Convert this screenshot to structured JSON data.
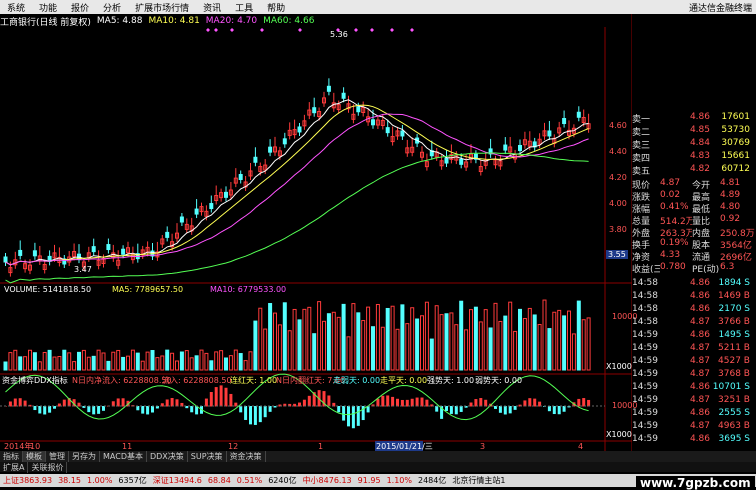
{
  "menu": {
    "items": [
      "系统",
      "功能",
      "报价",
      "分析",
      "扩展市场行情",
      "资讯",
      "工具",
      "帮助"
    ],
    "brand": "通达信金融终端"
  },
  "header": {
    "title": "工商银行(日线 前复权)",
    "ma5": "MA5: 4.88",
    "ma10": "MA10: 4.81",
    "ma20": "MA20: 4.70",
    "ma60": "MA60: 4.66",
    "high_label": "5.36",
    "low_label": "3.47"
  },
  "axis": {
    "price_ticks": [
      "4.60",
      "4.40",
      "4.20",
      "4.00",
      "3.80",
      "3.60"
    ],
    "current_price_tag": "3.55",
    "vol_ticks": [
      "10000"
    ],
    "vol_unit": "X1000",
    "ddx_ticks": [
      "10000"
    ],
    "ddx_unit": "X1000",
    "dates": [
      "2014年",
      "10",
      "11",
      "12",
      "1",
      "2015/01/21/三",
      "3",
      "4"
    ]
  },
  "volume_header": {
    "title": "VOLUME: 5141818.50",
    "ma5": "MA5: 7789657.50",
    "ma10": "MA10: 6779533.00"
  },
  "ddx_header": {
    "title": "资金博弈DDX指标",
    "n_inflow": "N日内净流入: 6228808.50",
    "inflow": "流入: 6228808.50",
    "streak": "连红天: 1.00",
    "n_streak": "N日内翻红天: 7.00",
    "net_days": "走弱天: 0.00",
    "down_days": "走平天: 0.00",
    "strong": "强势天: 1.00",
    "weak": "弱势天: 0.00"
  },
  "quote": {
    "asks": [
      {
        "label": "卖一",
        "price": "4.86",
        "vol": "17601"
      },
      {
        "label": "卖二",
        "price": "4.85",
        "vol": "53730"
      },
      {
        "label": "卖三",
        "price": "4.84",
        "vol": "30769"
      },
      {
        "label": "卖四",
        "price": "4.83",
        "vol": "15661"
      },
      {
        "label": "卖五",
        "price": "4.82",
        "vol": "60712"
      }
    ],
    "stats": [
      {
        "l1": "现价",
        "v1": "4.87",
        "l2": "今开",
        "v2": "4.81"
      },
      {
        "l1": "涨跌",
        "v1": "0.02",
        "l2": "最高",
        "v2": "4.89"
      },
      {
        "l1": "涨幅",
        "v1": "0.41%",
        "l2": "最低",
        "v2": "4.80"
      },
      {
        "l1": "总量",
        "v1": "514.2万",
        "l2": "量比",
        "v2": "0.92"
      },
      {
        "l1": "外盘",
        "v1": "263.3万",
        "l2": "内盘",
        "v2": "250.8万"
      },
      {
        "l1": "换手",
        "v1": "0.19%",
        "l2": "股本",
        "v2": "3564亿"
      },
      {
        "l1": "净资",
        "v1": "4.33",
        "l2": "流通",
        "v2": "2696亿"
      },
      {
        "l1": "收益(三)",
        "v1": "0.780",
        "l2": "PE(动)",
        "v2": "6.3"
      }
    ],
    "ticks": [
      {
        "t": "14:58",
        "p": "4.86",
        "v": "1894",
        "s": "S"
      },
      {
        "t": "14:58",
        "p": "4.86",
        "v": "1469",
        "s": "B"
      },
      {
        "t": "14:58",
        "p": "4.86",
        "v": "2170",
        "s": "S"
      },
      {
        "t": "14:58",
        "p": "4.87",
        "v": "3766",
        "s": "B"
      },
      {
        "t": "14:59",
        "p": "4.86",
        "v": "1495",
        "s": "S"
      },
      {
        "t": "14:59",
        "p": "4.87",
        "v": "5211",
        "s": "B"
      },
      {
        "t": "14:59",
        "p": "4.87",
        "v": "4527",
        "s": "B"
      },
      {
        "t": "14:59",
        "p": "4.87",
        "v": "3768",
        "s": "B"
      },
      {
        "t": "14:59",
        "p": "4.86",
        "v": "10701",
        "s": "S"
      },
      {
        "t": "14:59",
        "p": "4.87",
        "v": "3251",
        "s": "B"
      },
      {
        "t": "14:59",
        "p": "4.86",
        "v": "2555",
        "s": "S"
      },
      {
        "t": "14:59",
        "p": "4.87",
        "v": "4963",
        "s": "B"
      },
      {
        "t": "14:59",
        "p": "4.86",
        "v": "3695",
        "s": "S"
      }
    ]
  },
  "tabs": [
    "指标",
    "模板",
    "管理",
    "另存为",
    "MACD基本",
    "DDX决策",
    "SUP决策",
    "资金决策"
  ],
  "subtabs": [
    "扩展A",
    "关联报价"
  ],
  "status": {
    "sh": "上证3863.93",
    "sh_chg": "38.15",
    "sh_pct": "1.00%",
    "sh_amt": "6357亿",
    "sz": "深证13494.6",
    "sz_chg": "68.84",
    "sz_pct": "0.51%",
    "sz_amt": "6240亿",
    "zx": "中小8476.13",
    "zx_chg": "91.95",
    "zx_pct": "1.10%",
    "zx_amt": "2484亿",
    "server": "北京行情主站1"
  },
  "watermark": "www.7gpzb.com",
  "colors": {
    "up": "#ff3b3b",
    "down": "#54ffff",
    "ma5": "#ffffff",
    "ma10": "#ffff54",
    "ma20": "#ff54ff",
    "ma60": "#54ff54"
  }
}
